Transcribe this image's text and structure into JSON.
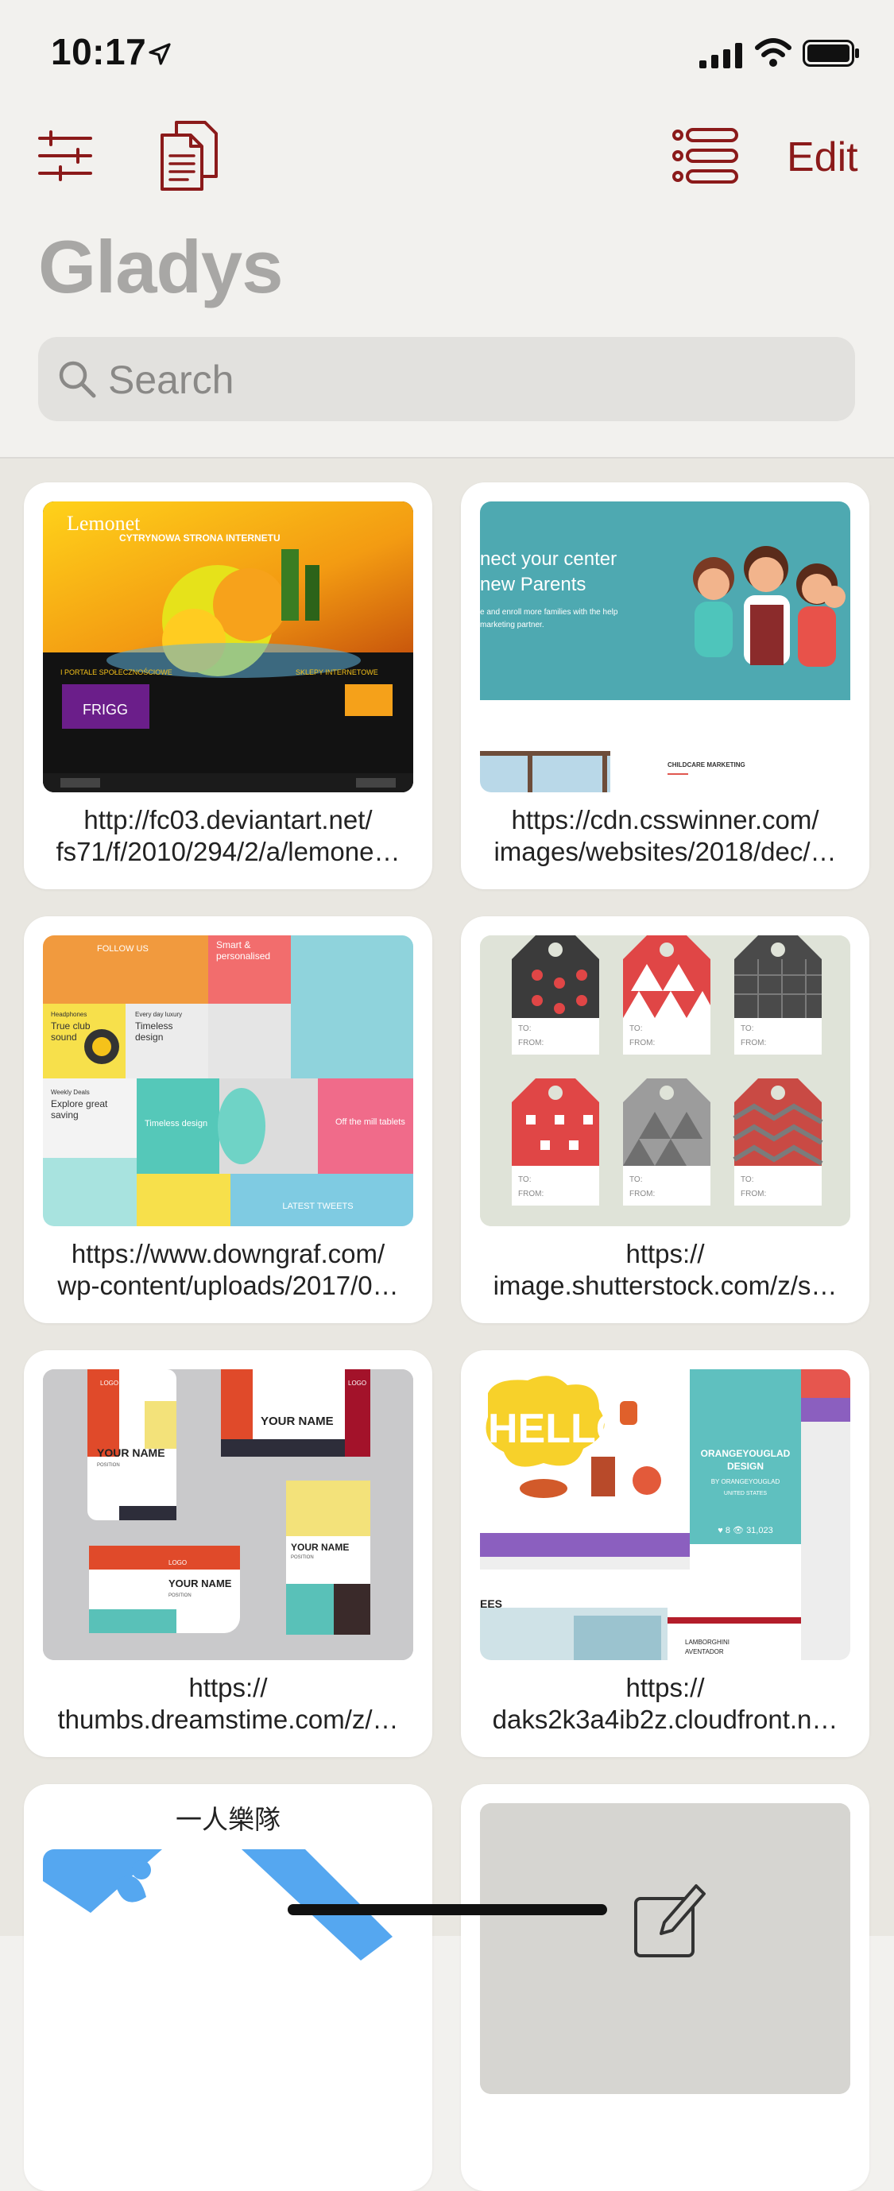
{
  "status": {
    "time": "10:17"
  },
  "toolbar": {
    "edit_label": "Edit"
  },
  "title": "Gladys",
  "search": {
    "placeholder": "Search",
    "value": ""
  },
  "colors": {
    "accent": "#8b1a1a",
    "title": "#a8a7a5",
    "background": "#f2f1ee"
  },
  "icons": {
    "filter": "sliders-icon",
    "document": "documents-icon",
    "list": "list-icon",
    "search": "magnifier-icon"
  },
  "cards": [
    {
      "caption1": "http://fc03.deviantart.net/",
      "caption2": "fs71/f/2010/294/2/a/lemone…",
      "thumb": {
        "logo": "Lemonet",
        "headline": "CYTRYNOWA STRONA INTERNETU",
        "left_label": "I PORTALE SPOŁECZNOŚCIOWE",
        "right_label": "SKLEPY INTERNETOWE",
        "badge": "FRIGG"
      }
    },
    {
      "caption1": "https://cdn.csswinner.com/",
      "caption2": "images/websites/2018/dec/…",
      "thumb": {
        "line1": "nect your center",
        "line2": "new Parents",
        "body1": "e and enroll more families with the help",
        "body2": "marketing partner.",
        "section": "CHILDCARE MARKETING"
      }
    },
    {
      "caption1": "https://www.downgraf.com/",
      "caption2": "wp-content/uploads/2017/0…",
      "thumb": {
        "follow": "FOLLOW US",
        "smart": "Smart &",
        "personalised": "personalised",
        "headphones": "Headphones",
        "true_club": "True club",
        "sound": "sound",
        "everyday": "Every day luxury",
        "timeless": "Timeless",
        "design": "design",
        "weekly": "Weekly Deals",
        "explore": "Explore great",
        "saving": "saving",
        "timeless2": "Timeless design",
        "off": "Off the mill tablets",
        "latest": "LATEST TWEETS"
      }
    },
    {
      "caption1": "https://",
      "caption2": "image.shutterstock.com/z/s…",
      "thumb": {
        "tag_to": "TO:",
        "tag_from": "FROM:"
      }
    },
    {
      "caption1": "https://",
      "caption2": "thumbs.dreamstime.com/z/…",
      "thumb": {
        "name": "YOUR NAME",
        "position": "POSITION",
        "logo": "LOGO"
      }
    },
    {
      "caption1": "https://",
      "caption2": "daks2k3a4ib2z.cloudfront.n…",
      "thumb": {
        "hello": "HELLO",
        "brand1": "ORANGEYOUGLAD",
        "brand2": "DESIGN",
        "by": "BY ORANGEYOUGLAD",
        "country": "UNITED STATES",
        "stats": "♥ 8   👁 31,023",
        "ees": "EES",
        "car1": "LAMBORGHINI",
        "car2": "AVENTADOR"
      }
    },
    {
      "title": "一人樂隊"
    },
    {
      "title": ""
    }
  ]
}
